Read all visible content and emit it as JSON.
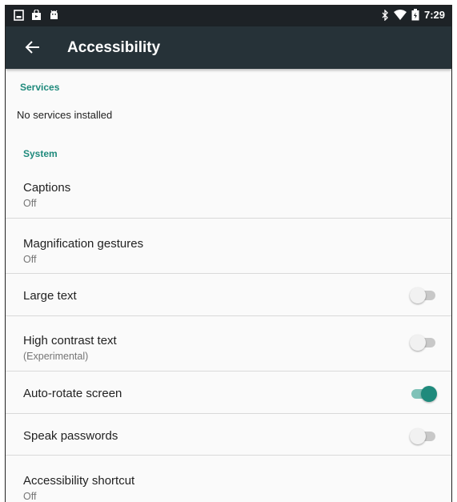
{
  "status_bar": {
    "time": "7:29",
    "left_icons": [
      "screenshot-icon",
      "store-bag-icon",
      "android-icon"
    ],
    "right_icons": [
      "bluetooth-icon",
      "wifi-icon",
      "battery-icon"
    ]
  },
  "app_bar": {
    "title": "Accessibility",
    "back_icon": "arrow-back-icon"
  },
  "services": {
    "header": "Services",
    "empty_text": "No services installed"
  },
  "system": {
    "header": "System",
    "items": [
      {
        "title": "Captions",
        "subtitle": "Off"
      },
      {
        "title": "Magnification gestures",
        "subtitle": "Off"
      },
      {
        "title": "Large text",
        "toggle": false
      },
      {
        "title": "High contrast text",
        "subtitle": "(Experimental)",
        "toggle": false
      },
      {
        "title": "Auto-rotate screen",
        "toggle": true
      },
      {
        "title": "Speak passwords",
        "toggle": false
      },
      {
        "title": "Accessibility shortcut",
        "subtitle": "Off"
      }
    ]
  },
  "colors": {
    "accent": "#1f8a7c",
    "app_bar": "#263238",
    "status_bar": "#1d2226"
  }
}
